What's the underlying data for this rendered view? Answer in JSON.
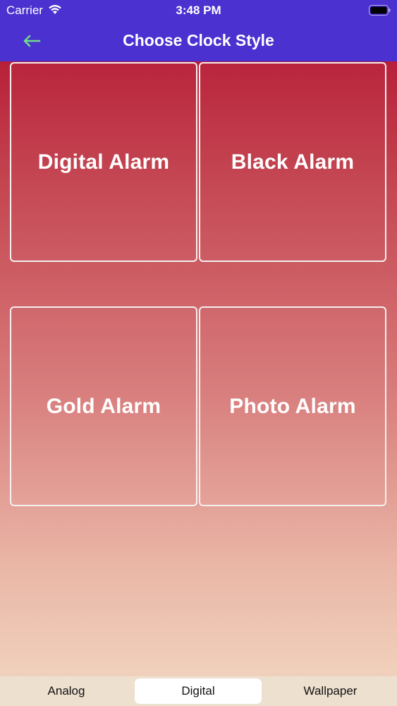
{
  "status_bar": {
    "carrier": "Carrier",
    "time": "3:48 PM",
    "icons": [
      "wifi-icon",
      "battery-icon"
    ]
  },
  "header": {
    "title": "Choose Clock Style",
    "back_icon": "back-arrow-icon",
    "back_icon_color": "#6fdc8c",
    "background_color": "#4a31d0"
  },
  "tiles": [
    {
      "label": "Digital Alarm"
    },
    {
      "label": "Black Alarm"
    },
    {
      "label": "Gold Alarm"
    },
    {
      "label": "Photo Alarm"
    }
  ],
  "tab_bar": {
    "tabs": [
      {
        "label": "Analog",
        "selected": false
      },
      {
        "label": "Digital",
        "selected": true
      },
      {
        "label": "Wallpaper",
        "selected": false
      }
    ]
  }
}
